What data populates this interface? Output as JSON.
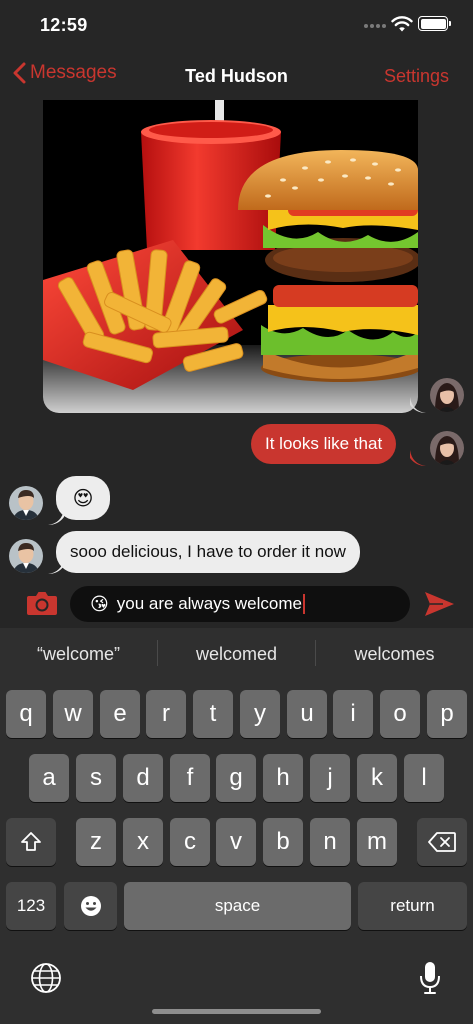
{
  "status_bar": {
    "time": "12:59"
  },
  "nav": {
    "back_label": "Messages",
    "title": "Ted Hudson",
    "settings_label": "Settings"
  },
  "messages": [
    {
      "type": "image",
      "direction": "outgoing",
      "content": "food-photo"
    },
    {
      "type": "text",
      "direction": "outgoing",
      "text": "It looks like that"
    },
    {
      "type": "emoji",
      "direction": "incoming",
      "text": "😍"
    },
    {
      "type": "text",
      "direction": "incoming",
      "text": "sooo delicious, I have to order it now"
    }
  ],
  "composer": {
    "emoji": "😘",
    "text": "you are always welcome"
  },
  "keyboard": {
    "suggestions": [
      "“welcome”",
      "welcomed",
      "welcomes"
    ],
    "row1": [
      "q",
      "w",
      "e",
      "r",
      "t",
      "y",
      "u",
      "i",
      "o",
      "p"
    ],
    "row2": [
      "a",
      "s",
      "d",
      "f",
      "g",
      "h",
      "j",
      "k",
      "l"
    ],
    "row3": [
      "z",
      "x",
      "c",
      "v",
      "b",
      "n",
      "m"
    ],
    "numbers_label": "123",
    "space_label": "space",
    "return_label": "return"
  },
  "colors": {
    "accent": "#c9362f",
    "background": "#262626",
    "incoming_bubble": "#ededed",
    "keyboard": "#2f2f2f"
  }
}
